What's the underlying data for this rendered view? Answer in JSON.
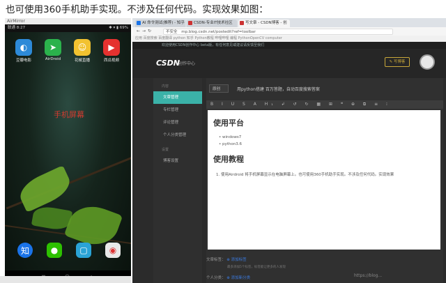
{
  "caption": "也可使用360手机助手实现。不涉及任何代码。实现效果如图：",
  "phone": {
    "app_name": "AirMirror",
    "status_left": "联通 8:27",
    "status_right": "✱ ▾ ▮ 69%",
    "label": "手机屏幕",
    "apps": [
      {
        "label": "豆瓣电影",
        "icon": "film-icon",
        "color": "#2d8ad8"
      },
      {
        "label": "AirDroid",
        "icon": "airdroid-icon",
        "color": "#2bb24c"
      },
      {
        "label": "花椒直播",
        "icon": "huajiao-icon",
        "color": "#f2c230"
      },
      {
        "label": "西瓜视频",
        "icon": "xigua-icon",
        "color": "#e5312f"
      }
    ],
    "dock": [
      {
        "icon": "zhi-icon",
        "glyph": "知",
        "color": "#1a73e8"
      },
      {
        "icon": "wechat-icon",
        "glyph": "●",
        "color": "#2dc100"
      },
      {
        "icon": "app-icon",
        "glyph": "▢",
        "color": "#2aa3d6"
      },
      {
        "icon": "chrome-icon",
        "glyph": "◉",
        "color": "#e8e8e8"
      }
    ]
  },
  "browser": {
    "tabs": [
      {
        "label": "AI 命令测试(推荐) - 知乎"
      },
      {
        "label": "CSDN-专业IT技术社区"
      },
      {
        "label": "写文章 - CSDN博客 - 创"
      }
    ],
    "url": "mp.blog.csdn.net/postedit?ref=toolbar",
    "secure_label": "不安全",
    "bookmarks": "应用   百度搜索   百度翻译   python   知乎   Python教程   哔哩哔哩   编程   PythonOpenCV   computer",
    "notice": "欢迎使用CSDN创作中心 beta版，有任何意见或建议请反馈至我们",
    "logo": "CSDN",
    "logo_sub": "创作中心",
    "write_button": "写博客",
    "sidebar": {
      "group1": "内容",
      "items1": [
        "文章管理",
        "专栏管理",
        "评论管理",
        "个人分类管理"
      ],
      "group2": "设置",
      "items2": [
        "博客设置"
      ]
    },
    "editor": {
      "category": "原创",
      "title": "用python搭建 百万答题，自动百度搜索答案",
      "toolbar": "B I U S A H₁ ↲ ↺ ↻ ▦ ⊞ ❝ ⊕ ⧉ ≡ ⁝",
      "heading1": "使用平台",
      "bullets": [
        "windows7",
        "python3.6"
      ],
      "heading2": "使用教程",
      "step1": "1. 使用Airdroid 将手机屏幕显示在电脑屏幕上。也可使用360手机助手实现。不涉及任何代码。实现效果",
      "meta_label": "文章标签：",
      "meta_add": "添加标签",
      "meta_hint": "最多添加5个标签，标签能让更多的人发现",
      "meta_label2": "个人分类：",
      "meta_add2": "添加新分类"
    }
  },
  "watermark": "https://blog..."
}
